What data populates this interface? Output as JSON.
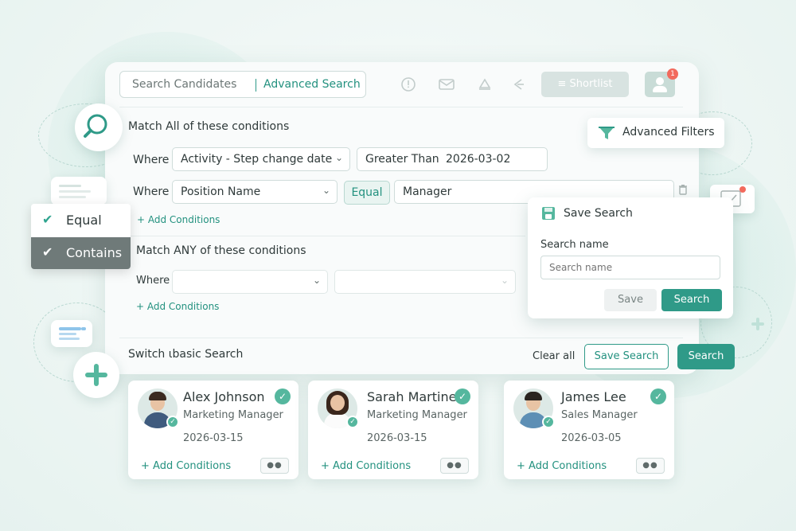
{
  "header": {
    "search_placeholder": "Search Candidates",
    "advanced_search": "Advanced Search",
    "shortlist": "Shortlist",
    "notification_count": "1"
  },
  "filters_widget": {
    "label": "Advanced Filters"
  },
  "match_all": {
    "title": "Match All of these conditions",
    "rows": [
      {
        "where": "Where",
        "field": "Activity - Step change date",
        "operator": "Greater Than",
        "value": "2026-03-02"
      },
      {
        "where": "Where",
        "field": "Position Name",
        "operator": "Equal",
        "value": "Manager"
      }
    ],
    "add_label": "+ Add Conditions"
  },
  "operator_dropdown": {
    "options": [
      {
        "label": "Equal",
        "selected": false
      },
      {
        "label": "Contains",
        "selected": true
      }
    ]
  },
  "match_any": {
    "title": "Match ANY of these conditions",
    "where": "Where",
    "add_label": "+ Add Conditions"
  },
  "save_search_popup": {
    "title": "Save Search",
    "name_label": "Search name",
    "name_placeholder": "Search name",
    "save": "Save",
    "search": "Search"
  },
  "footer": {
    "switch_label": "Switch ιbasic Search",
    "clear_all": "Clear all",
    "save_search": "Save Search",
    "search": "Search"
  },
  "candidates": [
    {
      "name": "Alex Johnson",
      "role": "Marketing Manager",
      "date": "2026-03-15",
      "add_label": "+ Add Conditions"
    },
    {
      "name": "Sarah Martinez",
      "role": "Marketing Manager",
      "date": "2026-03-15",
      "add_label": "+ Add Conditions"
    },
    {
      "name": "James Lee",
      "role": "Sales Manager",
      "date": "2026-03-05",
      "add_label": "+ Add Conditions"
    }
  ],
  "colors": {
    "accent": "#2f9a88",
    "accent_text": "#23917f",
    "badge": "#f26a5d"
  }
}
